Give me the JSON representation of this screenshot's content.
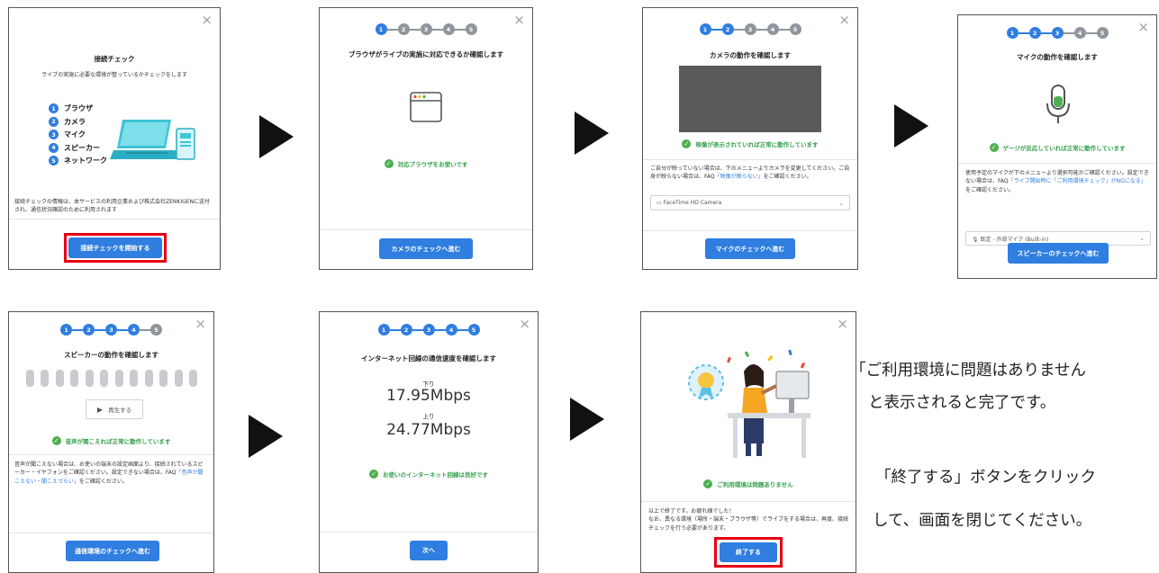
{
  "close_glyph": "×",
  "panel1": {
    "title": "接続チェック",
    "subtitle": "ライブの実施に必要な環境が整っているかチェックをします",
    "items": [
      "ブラウザ",
      "カメラ",
      "マイク",
      "スピーカー",
      "ネットワーク"
    ],
    "notice": "接続チェックの情報は、本サービスの利用企業および株式会社ZENKIGENに送付され、通信状況確認のために利用されます",
    "button": "接続チェックを開始する"
  },
  "panel2": {
    "title": "ブラウザがライブの実施に対応できるか確認します",
    "status": "対応ブラウザをお使いです",
    "button": "カメラのチェックへ進む"
  },
  "panel3": {
    "title": "カメラの動作を確認します",
    "status": "映像が表示されていれば正常に動作しています",
    "help_a": "ご自分が映っていない場合は、下のメニューよりカメラを変更してください。ご自身が映らない場合は、FAQ",
    "help_link": "「映像が映らない」",
    "help_b": "をご確認ください。",
    "select": "FaceTime HD Camera",
    "button": "マイクのチェックへ進む"
  },
  "panel4": {
    "title": "マイクの動作を確認します",
    "status": "ゲージが反応していれば正常に動作しています",
    "help_a": "使用予定のマイクが下のメニューより選択可能かご確認ください。設定できない場合は、FAQ",
    "help_link": "「ライブ開始時に「ご利用環境チェック」がNGになる」",
    "help_b": "をご確認ください。",
    "select": "既定 - 外部マイク (Built-in)",
    "button": "スピーカーのチェックへ進む"
  },
  "panel5": {
    "title": "スピーカーの動作を確認します",
    "play": "再生する",
    "status": "音声が聞こえれば正常に動作しています",
    "help_a": "音声が聞こえない場合は、お使いの端末の設定画面より、接続されているスピーカー・イヤフォンをご確認ください。設定できない場合は、FAQ",
    "help_link": "「音声が聞こえない・聞こえづらい」",
    "help_b": "をご確認ください。",
    "button": "通信環境のチェックへ進む"
  },
  "panel6": {
    "title": "インターネット回線の通信速度を確認します",
    "down_label": "下り",
    "down_value": "17.95Mbps",
    "up_label": "上り",
    "up_value": "24.77Mbps",
    "status": "お使いのインターネット回線は良好です",
    "button": "次へ"
  },
  "panel7": {
    "status": "ご利用環境は問題ありません",
    "line1": "以上で終了です。お疲れ様でした！",
    "line2": "なお、異なる環境（場所・端末・ブラウザ等）でライブをする場合は、再度、接続チェックを行う必要があります。",
    "button": "終了する"
  },
  "steps": [
    "1",
    "2",
    "3",
    "4",
    "5"
  ],
  "side": {
    "line1": "「ご利用環境に問題はありません",
    "line2": "と表示されると完了です。",
    "line3": "「終了する」ボタンをクリック",
    "line4": "して、画面を閉じてください。"
  },
  "colors": {
    "accent": "#2f7ee0",
    "success": "#4cb050",
    "highlight": "#e60012",
    "inactive": "#8f959c"
  }
}
